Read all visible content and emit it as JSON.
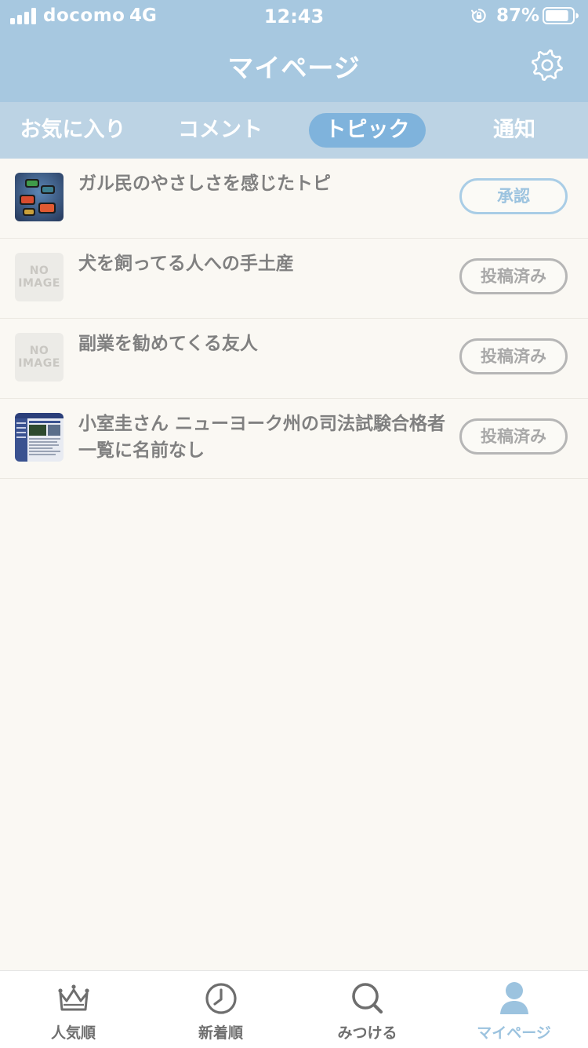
{
  "status_bar": {
    "carrier": "docomo",
    "network": "4G",
    "time": "12:43",
    "battery": "87%",
    "battery_level": 0.87,
    "signal_bars": 4
  },
  "header": {
    "title": "マイページ",
    "settings_icon": "gear-icon"
  },
  "tabs": [
    {
      "label": "お気に入り",
      "active": false
    },
    {
      "label": "コメント",
      "active": false
    },
    {
      "label": "トピック",
      "active": true
    },
    {
      "label": "通知",
      "active": false
    }
  ],
  "topics": [
    {
      "title": "ガル民のやさしさを感じたトピ",
      "status": "承認",
      "thumbnail": "photo"
    },
    {
      "title": "犬を飼ってる人への手土産",
      "status": "投稿済み",
      "thumbnail": "no-image"
    },
    {
      "title": "副業を勧めてくる友人",
      "status": "投稿済み",
      "thumbnail": "no-image"
    },
    {
      "title": "小室圭さん ニューヨーク州の司法試験合格者一覧に名前なし",
      "status": "投稿済み",
      "thumbnail": "webpage"
    }
  ],
  "no_image": {
    "line1": "NO",
    "line2": "IMAGE"
  },
  "tab_bar": [
    {
      "label": "人気順",
      "icon": "crown-icon",
      "active": false
    },
    {
      "label": "新着順",
      "icon": "clock-icon",
      "active": false
    },
    {
      "label": "みつける",
      "icon": "search-icon",
      "active": false
    },
    {
      "label": "マイページ",
      "icon": "person-icon",
      "active": true
    }
  ],
  "colors": {
    "header_bg": "#a7c8e0",
    "tabs_bg": "#bcd3e4",
    "accent": "#7fb3dc",
    "page_bg": "#faf8f3"
  }
}
